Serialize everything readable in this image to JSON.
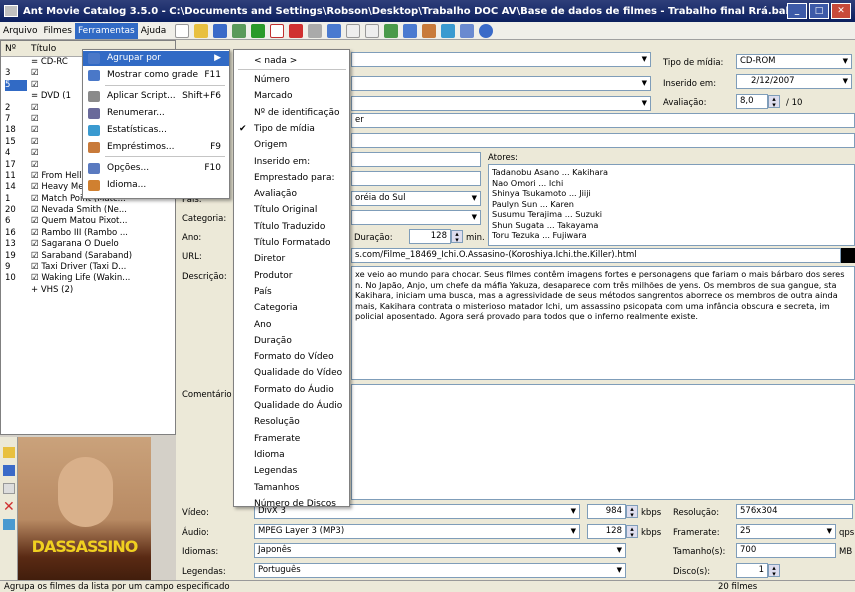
{
  "window": {
    "title": "Ant Movie Catalog 3.5.0 - C:\\Documents and Settings\\Robson\\Desktop\\Trabalho DOC AV\\Base de dados de filmes - Trabalho final Rrá.bak",
    "buttons": [
      "_",
      "□",
      "✕"
    ]
  },
  "menubar": [
    "Arquivo",
    "Filmes",
    "Ferramentas",
    "Ajuda"
  ],
  "tree": {
    "col_num": "Nº",
    "col_title": "Título",
    "rows": [
      {
        "num": "",
        "title": "= CD-RC"
      },
      {
        "num": "3",
        "title": "☑"
      },
      {
        "num": "5",
        "title": "☑"
      },
      {
        "num": "",
        "title": "= DVD (1"
      },
      {
        "num": "2",
        "title": "☑"
      },
      {
        "num": "7",
        "title": "☑"
      },
      {
        "num": "18",
        "title": "☑"
      },
      {
        "num": "15",
        "title": "☑"
      },
      {
        "num": "4",
        "title": "☑"
      },
      {
        "num": "17",
        "title": "☑"
      },
      {
        "num": "11",
        "title": "☑ From Hell (Do Infer..."
      },
      {
        "num": "14",
        "title": "☑ Heavy Metal 2000 ..."
      },
      {
        "num": "1",
        "title": "☑ Match Point (Matc..."
      },
      {
        "num": "20",
        "title": "☑ Nevada Smith (Ne..."
      },
      {
        "num": "6",
        "title": "☑ Quem Matou Pixot..."
      },
      {
        "num": "16",
        "title": "☑ Rambo III (Rambo ..."
      },
      {
        "num": "13",
        "title": "☑ Sagarana O Duelo"
      },
      {
        "num": "19",
        "title": "☑ Saraband (Saraband)"
      },
      {
        "num": "9",
        "title": "☑ Taxi Driver (Taxi D..."
      },
      {
        "num": "10",
        "title": "☑ Waking Life (Wakin..."
      },
      {
        "num": "",
        "title": "+ VHS (2)"
      }
    ]
  },
  "tools_menu": {
    "items": [
      {
        "label": "Agrupar por",
        "shortcut": "▶",
        "icon": "group-icon",
        "color": "#4a78c8"
      },
      {
        "label": "Mostrar como grade",
        "shortcut": "F11",
        "icon": "grid-icon",
        "color": "#4a78c8"
      },
      {
        "label": "Aplicar Script...",
        "shortcut": "Shift+F6",
        "icon": "script-icon",
        "color": "#8a8a8a"
      },
      {
        "label": "Renumerar...",
        "shortcut": "",
        "icon": "renumber-icon",
        "color": "#6a6a9a"
      },
      {
        "label": "Estatísticas...",
        "shortcut": "",
        "icon": "stats-icon",
        "color": "#3a9ad0"
      },
      {
        "label": "Empréstimos...",
        "shortcut": "F9",
        "icon": "loans-icon",
        "color": "#c87a3a"
      },
      {
        "label": "Opções...",
        "shortcut": "F10",
        "icon": "options-icon",
        "color": "#5a7ac0"
      },
      {
        "label": "Idioma...",
        "shortcut": "",
        "icon": "language-icon",
        "color": "#d08030"
      }
    ]
  },
  "group_submenu": {
    "checked_index": 3,
    "items": [
      "< nada >",
      "Número",
      "Marcado",
      "Nº de identificação",
      "Tipo de mídia",
      "Origem",
      "Inserido em:",
      "Emprestado para:",
      "Avaliação",
      "Título Original",
      "Título Traduzido",
      "Título Formatado",
      "Diretor",
      "Produtor",
      "País",
      "Categoria",
      "Ano",
      "Duração",
      "Formato do Vídeo",
      "Qualidade do Vídeo",
      "Formato do Áudio",
      "Qualidade do Áudio",
      "Resolução",
      "Framerate",
      "Idioma",
      "Legendas",
      "Tamanhos",
      "Número de Discos"
    ]
  },
  "details": {
    "media_type_label": "Tipo de mídia:",
    "media_type": "CD-ROM",
    "inserted_label": "Inserido em:",
    "inserted": "2/12/2007",
    "rating_label": "Avaliação:",
    "rating": "8,0",
    "rating_max": "/ 10",
    "partial_er": "er",
    "actors_label": "Atores:",
    "actors": [
      "Tadanobu Asano ... Kakihara",
      "Nao Omori ... Ichi",
      "Shinya Tsukamoto ... Jiiji",
      "Paulyn Sun ... Karen",
      "Susumu Terajima ... Suzuki",
      "Shun Sugata ... Takayama",
      "Toru Tezuka ... Fujiwara"
    ],
    "country_label": "País:",
    "country": "oréia do Sul",
    "category_label": "Categoria:",
    "year_label": "Ano:",
    "duration_label": "Duração:",
    "duration": "128",
    "duration_unit": "min.",
    "url_label": "URL:",
    "url": "s.com/Filme_18469_Ichi.O.Assasino-(Koroshiya.Ichi.the.Killer).html",
    "description_label": "Descrição:",
    "description": "xe veio ao mundo para chocar. Seus filmes contêm imagens fortes e personagens que fariam o mais bárbaro dos seres n. No Japão, Anjo, um chefe da máfia Yakuza, desaparece com três milhões de yens. Os membros de sua gangue, sta Kakihara, iniciam uma busca, mas a agressividade de seus métodos sangrentos aborrece os membros de outra ainda mais, Kakihara contrata o misterioso matador Ichi, um assassino psicopata com uma infância obscura e secreta, im policial aposentado. Agora será provado para todos que o inferno realmente existe.",
    "comments_label": "Comentário",
    "video_label": "Vídeo:",
    "video": "DivX 3",
    "video_kbps": "984",
    "kbps": "kbps",
    "audio_label": "Áudio:",
    "audio": "MPEG Layer 3 (MP3)",
    "audio_kbps": "128",
    "languages_label": "Idiomas:",
    "languages": "Japonês",
    "subtitles_label": "Legendas:",
    "subtitles": "Português",
    "resolution_label": "Resolução:",
    "resolution": "576x304",
    "framerate_label": "Framerate:",
    "framerate": "25",
    "fps": "qps",
    "size_label": "Tamanho(s):",
    "size": "700",
    "mb": "MB",
    "discs_label": "Disco(s):",
    "discs": "1"
  },
  "poster_text": "DASSASSINO",
  "status": {
    "left": "Agrupa os filmes da lista por um campo especificado",
    "right": "20 filmes"
  }
}
